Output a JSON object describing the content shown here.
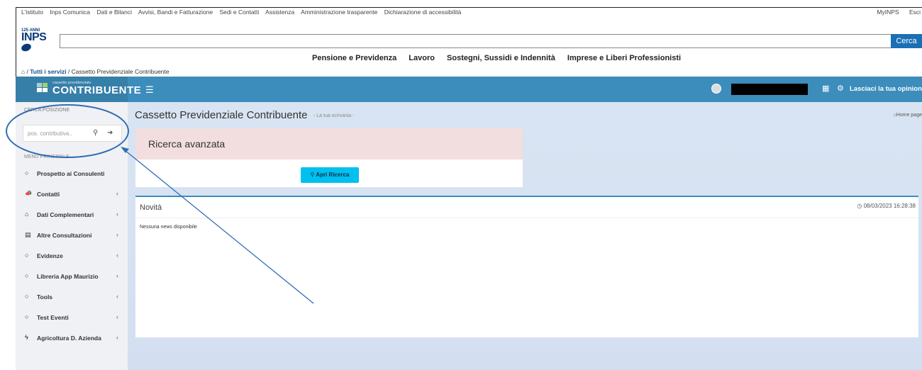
{
  "top_links": {
    "items": [
      "L'istituto",
      "Inps Comunica",
      "Dati e Bilanci",
      "Avvisi, Bandi e Fatturazione",
      "Sedi e Contatti",
      "Assistenza",
      "Amministrazione trasparente",
      "Dichiarazione di accessibilità"
    ],
    "right": [
      "MyINPS",
      "Esci"
    ]
  },
  "logo": {
    "anni": "125 ANNI",
    "inps": "INPS"
  },
  "search": {
    "button": "Cerca",
    "value": ""
  },
  "main_nav": [
    "Pensione e Previdenza",
    "Lavoro",
    "Sostegni, Sussidi e Indennità",
    "Imprese e Liberi Professionisti"
  ],
  "breadcrumb": {
    "first": "Tutti i servizi",
    "sep": " / ",
    "current": "Cassetto Previdenziale Contribuente"
  },
  "app_header": {
    "brand_small": "cassetto previdenziale",
    "brand_big": "CONTRIBUENTE",
    "opinion_link": "Lasciaci la tua opinione"
  },
  "sidebar": {
    "search_title": "CERCA POSIZIONE",
    "search_placeholder": "pos. contributiva..",
    "menu_title": "MENU PRINCIPALE",
    "items": [
      {
        "label": "Prospetto ai Consulenti",
        "icon": "circle-icon",
        "chevron": false
      },
      {
        "label": "Contatti",
        "icon": "megaphone-icon",
        "chevron": true
      },
      {
        "label": "Dati Complementari",
        "icon": "bank-icon",
        "chevron": true
      },
      {
        "label": "Altre Consultazioni",
        "icon": "list-icon",
        "chevron": true
      },
      {
        "label": "Evidenze",
        "icon": "circle-icon",
        "chevron": true
      },
      {
        "label": "Libreria App Maurizio",
        "icon": "circle-icon",
        "chevron": true
      },
      {
        "label": "Tools",
        "icon": "circle-icon",
        "chevron": true
      },
      {
        "label": "Test Eventi",
        "icon": "circle-icon",
        "chevron": true
      },
      {
        "label": "Agricoltura D. Azienda",
        "icon": "bolt-icon",
        "chevron": true
      }
    ]
  },
  "content": {
    "title": "Cassetto Previdenziale Contribuente",
    "subtitle": "- La tua scrivania -",
    "home_link": "Home page",
    "advanced_search": {
      "title": "Ricerca avanzata",
      "button": "Apri Ricerca"
    },
    "news": {
      "title": "Novità",
      "timestamp": "08/03/2023 16:28:38",
      "empty_text": "Nessuna news disponibile"
    }
  },
  "colors": {
    "header_blue": "#3c8dbc",
    "brand_blue": "#367fa9",
    "button_cyan": "#00c0ef",
    "alert_pink": "#f2dede",
    "annotation_blue": "#2f6eb5"
  }
}
